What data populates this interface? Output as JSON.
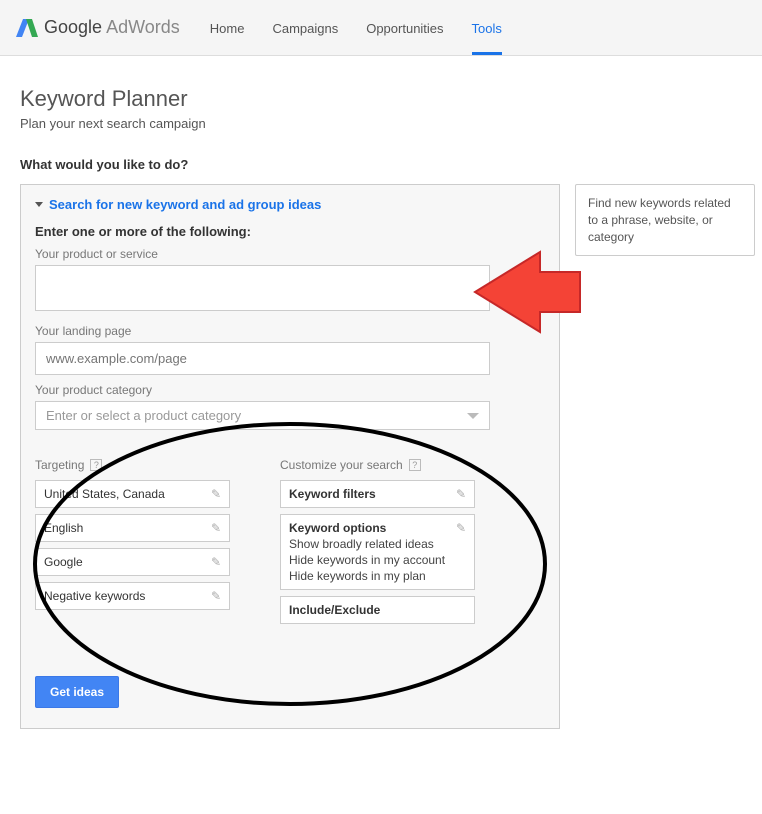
{
  "header": {
    "brand_main": "Google",
    "brand_sub": "AdWords",
    "nav": {
      "home": "Home",
      "campaigns": "Campaigns",
      "opportunities": "Opportunities",
      "tools": "Tools"
    }
  },
  "page": {
    "title": "Keyword Planner",
    "subtitle": "Plan your next search campaign",
    "prompt": "What would you like to do?"
  },
  "accordion": {
    "title": "Search for new keyword and ad group ideas"
  },
  "form": {
    "enter_label": "Enter one or more of the following:",
    "product_label": "Your product or service",
    "product_value": "",
    "landing_label": "Your landing page",
    "landing_placeholder": "www.example.com/page",
    "landing_value": "",
    "category_label": "Your product category",
    "category_placeholder": "Enter or select a product category"
  },
  "targeting": {
    "title": "Targeting",
    "items": [
      "United States, Canada",
      "English",
      "Google",
      "Negative keywords"
    ]
  },
  "customize": {
    "title": "Customize your search",
    "keyword_filters": "Keyword filters",
    "keyword_options_title": "Keyword options",
    "keyword_options_lines": [
      "Show broadly related ideas",
      "Hide keywords in my account",
      "Hide keywords in my plan"
    ],
    "include_exclude": "Include/Exclude"
  },
  "button": {
    "get_ideas": "Get ideas"
  },
  "callout": {
    "text": "Find new keywords related to a phrase, website, or category"
  }
}
